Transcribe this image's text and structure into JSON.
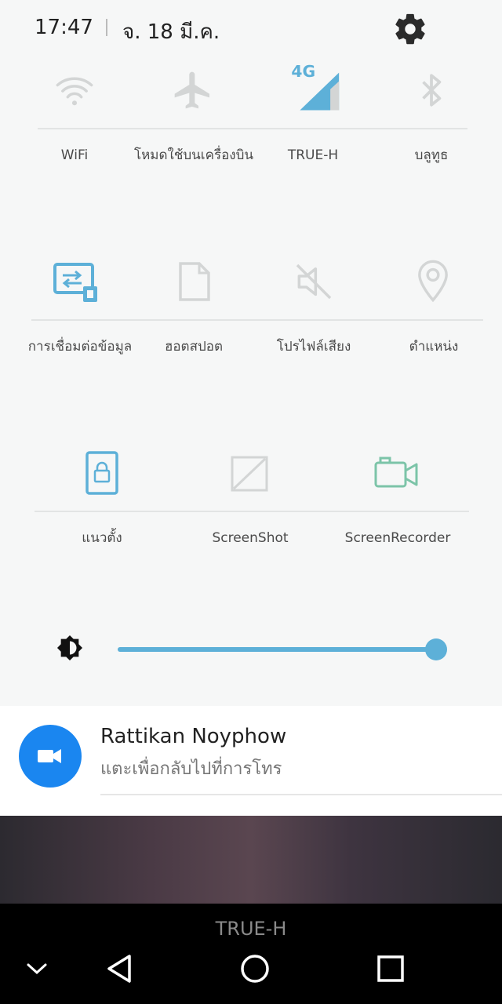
{
  "status": {
    "time": "17:47",
    "date": "จ. 18 มี.ค."
  },
  "tiles": {
    "row1": [
      {
        "label": "WiFi",
        "icon": "wifi-icon",
        "active": false
      },
      {
        "label": "โหมดใช้บนเครื่องบิน",
        "icon": "airplane-icon",
        "active": false
      },
      {
        "label": "TRUE-H",
        "icon": "mobile-data-4g-icon",
        "active": true,
        "badge": "4G"
      },
      {
        "label": "บลูทูธ",
        "icon": "bluetooth-icon",
        "active": false
      }
    ],
    "row2": [
      {
        "label": "การเชื่อมต่อข้อมูล",
        "icon": "data-connection-icon",
        "active": true
      },
      {
        "label": "ฮอตสปอต",
        "icon": "hotspot-icon",
        "active": false
      },
      {
        "label": "โปรไฟล์เสียง",
        "icon": "sound-profile-icon",
        "active": false
      },
      {
        "label": "ตำแหน่ง",
        "icon": "location-icon",
        "active": false
      }
    ],
    "row3": [
      {
        "label": "แนวตั้ง",
        "icon": "portrait-lock-icon",
        "active": true
      },
      {
        "label": "ScreenShot",
        "icon": "screenshot-icon",
        "active": false
      },
      {
        "label": "ScreenRecorder",
        "icon": "screen-recorder-icon",
        "active": false
      }
    ]
  },
  "brightness": {
    "level": 0.99
  },
  "notification": {
    "title": "Rattikan Noyphow",
    "text": "แตะเพื่อกลับไปที่การโทร"
  },
  "navbar": {
    "carrier": "TRUE-H"
  },
  "colors": {
    "accent": "#5db0d8",
    "inactive": "#d3d5d5",
    "call": "#1a86f0"
  }
}
